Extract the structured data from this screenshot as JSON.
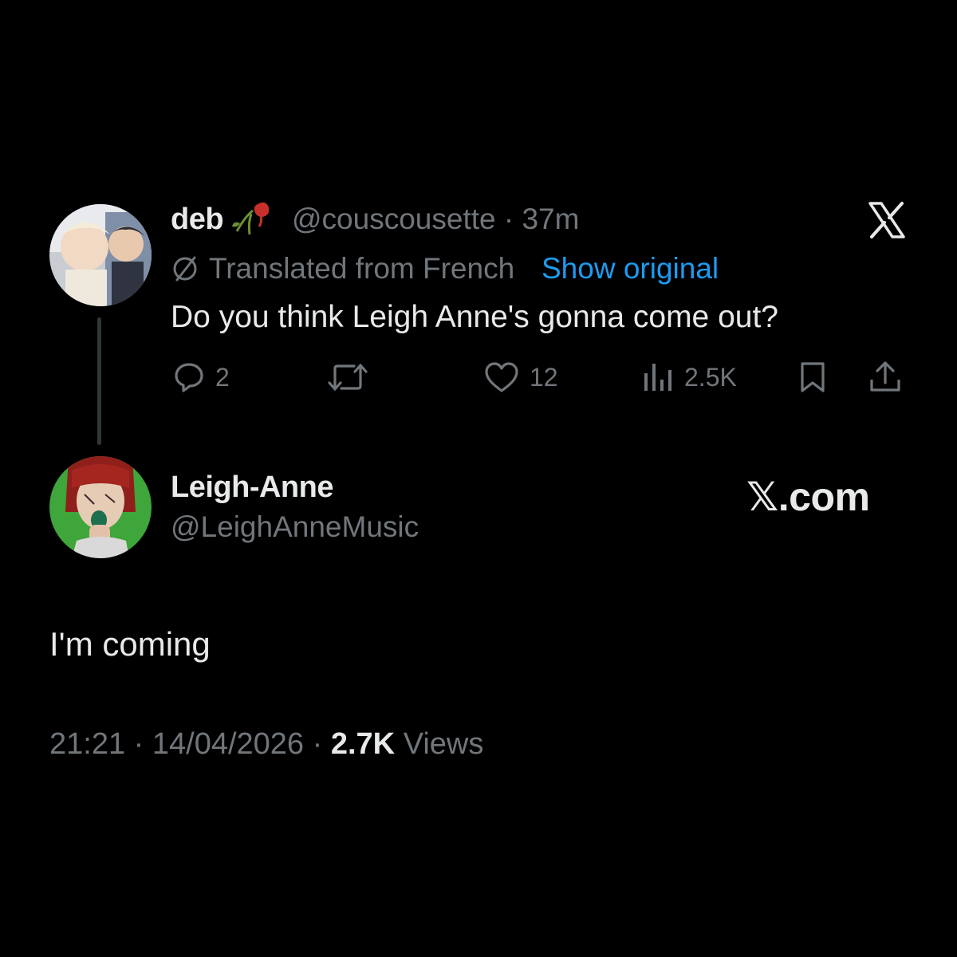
{
  "parent_tweet": {
    "display_name": "deb",
    "name_emoji": "wilted-rose-emoji",
    "handle": "@couscousette",
    "separator": "·",
    "time_ago": "37m",
    "translation_note": "Translated from French",
    "show_original_label": "Show original",
    "text": "Do you think Leigh Anne's gonna come out?",
    "actions": {
      "replies": "2",
      "reposts": "",
      "likes": "12",
      "views": "2.5K"
    }
  },
  "reply_tweet": {
    "display_name": "Leigh-Anne",
    "handle": "@LeighAnneMusic",
    "text": "I'm coming",
    "time": "21:21",
    "separator": "·",
    "date": "14/04/2026",
    "views_count": "2.7K",
    "views_label": "Views"
  },
  "branding": {
    "x_com_label": "𝕏.com"
  },
  "icons": {
    "reply": "speech-bubble-icon",
    "repost": "repost-arrows-icon",
    "like": "heart-icon",
    "views": "bar-chart-icon",
    "bookmark": "bookmark-icon",
    "share": "share-upload-icon",
    "translate": "slashed-circle-icon",
    "brand": "x-logo-icon"
  },
  "colors": {
    "background": "#000000",
    "primary_text": "#e7e9ea",
    "secondary_text": "#71767b",
    "link": "#1d9bf0"
  }
}
